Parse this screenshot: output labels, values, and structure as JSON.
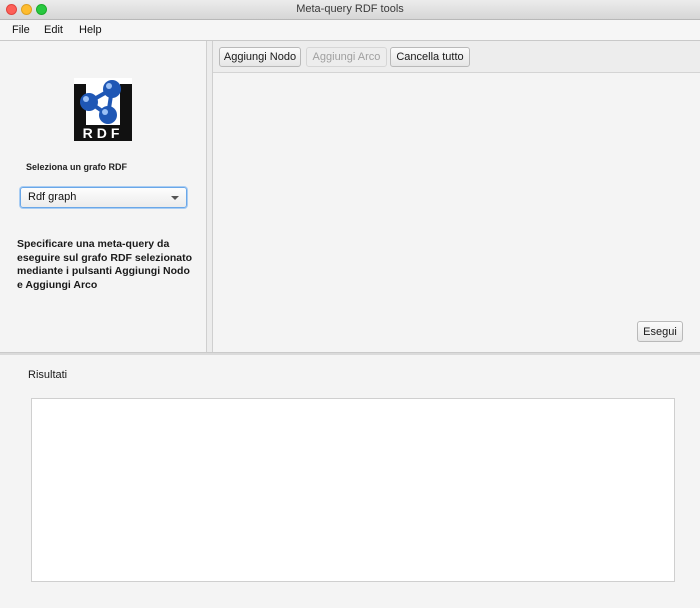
{
  "window": {
    "title": "Meta-query RDF tools"
  },
  "menu": {
    "file": "File",
    "edit": "Edit",
    "help": "Help"
  },
  "logo": {
    "text": "RDF"
  },
  "left": {
    "select_label": "Seleziona un grafo RDF",
    "graph_select_value": "Rdf graph",
    "instructions": "Specificare una meta-query da eseguire sul grafo RDF selezionato mediante i pulsanti Aggiungi Nodo e Aggiungi Arco"
  },
  "toolbar": {
    "add_node": "Aggiungi Nodo",
    "add_edge": "Aggiungi Arco",
    "clear_all": "Cancella tutto"
  },
  "canvas": {
    "run": "Esegui"
  },
  "results": {
    "label": "Risultati"
  },
  "colors": {
    "logo_blue": "#1f57b5",
    "focus": "#6aa7e8"
  }
}
